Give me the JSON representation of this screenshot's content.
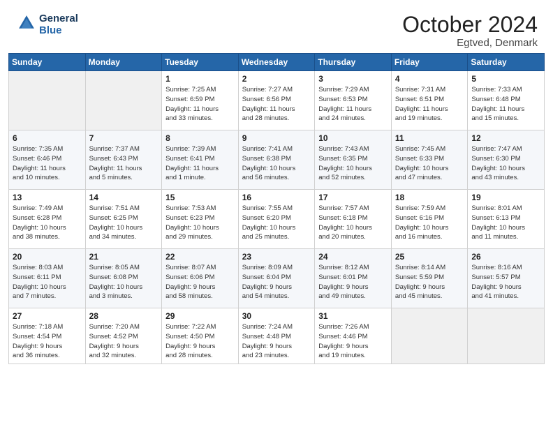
{
  "header": {
    "logo_line1": "General",
    "logo_line2": "Blue",
    "month": "October 2024",
    "location": "Egtved, Denmark"
  },
  "weekdays": [
    "Sunday",
    "Monday",
    "Tuesday",
    "Wednesday",
    "Thursday",
    "Friday",
    "Saturday"
  ],
  "rows": [
    [
      {
        "day": "",
        "detail": ""
      },
      {
        "day": "",
        "detail": ""
      },
      {
        "day": "1",
        "detail": "Sunrise: 7:25 AM\nSunset: 6:59 PM\nDaylight: 11 hours\nand 33 minutes."
      },
      {
        "day": "2",
        "detail": "Sunrise: 7:27 AM\nSunset: 6:56 PM\nDaylight: 11 hours\nand 28 minutes."
      },
      {
        "day": "3",
        "detail": "Sunrise: 7:29 AM\nSunset: 6:53 PM\nDaylight: 11 hours\nand 24 minutes."
      },
      {
        "day": "4",
        "detail": "Sunrise: 7:31 AM\nSunset: 6:51 PM\nDaylight: 11 hours\nand 19 minutes."
      },
      {
        "day": "5",
        "detail": "Sunrise: 7:33 AM\nSunset: 6:48 PM\nDaylight: 11 hours\nand 15 minutes."
      }
    ],
    [
      {
        "day": "6",
        "detail": "Sunrise: 7:35 AM\nSunset: 6:46 PM\nDaylight: 11 hours\nand 10 minutes."
      },
      {
        "day": "7",
        "detail": "Sunrise: 7:37 AM\nSunset: 6:43 PM\nDaylight: 11 hours\nand 5 minutes."
      },
      {
        "day": "8",
        "detail": "Sunrise: 7:39 AM\nSunset: 6:41 PM\nDaylight: 11 hours\nand 1 minute."
      },
      {
        "day": "9",
        "detail": "Sunrise: 7:41 AM\nSunset: 6:38 PM\nDaylight: 10 hours\nand 56 minutes."
      },
      {
        "day": "10",
        "detail": "Sunrise: 7:43 AM\nSunset: 6:35 PM\nDaylight: 10 hours\nand 52 minutes."
      },
      {
        "day": "11",
        "detail": "Sunrise: 7:45 AM\nSunset: 6:33 PM\nDaylight: 10 hours\nand 47 minutes."
      },
      {
        "day": "12",
        "detail": "Sunrise: 7:47 AM\nSunset: 6:30 PM\nDaylight: 10 hours\nand 43 minutes."
      }
    ],
    [
      {
        "day": "13",
        "detail": "Sunrise: 7:49 AM\nSunset: 6:28 PM\nDaylight: 10 hours\nand 38 minutes."
      },
      {
        "day": "14",
        "detail": "Sunrise: 7:51 AM\nSunset: 6:25 PM\nDaylight: 10 hours\nand 34 minutes."
      },
      {
        "day": "15",
        "detail": "Sunrise: 7:53 AM\nSunset: 6:23 PM\nDaylight: 10 hours\nand 29 minutes."
      },
      {
        "day": "16",
        "detail": "Sunrise: 7:55 AM\nSunset: 6:20 PM\nDaylight: 10 hours\nand 25 minutes."
      },
      {
        "day": "17",
        "detail": "Sunrise: 7:57 AM\nSunset: 6:18 PM\nDaylight: 10 hours\nand 20 minutes."
      },
      {
        "day": "18",
        "detail": "Sunrise: 7:59 AM\nSunset: 6:16 PM\nDaylight: 10 hours\nand 16 minutes."
      },
      {
        "day": "19",
        "detail": "Sunrise: 8:01 AM\nSunset: 6:13 PM\nDaylight: 10 hours\nand 11 minutes."
      }
    ],
    [
      {
        "day": "20",
        "detail": "Sunrise: 8:03 AM\nSunset: 6:11 PM\nDaylight: 10 hours\nand 7 minutes."
      },
      {
        "day": "21",
        "detail": "Sunrise: 8:05 AM\nSunset: 6:08 PM\nDaylight: 10 hours\nand 3 minutes."
      },
      {
        "day": "22",
        "detail": "Sunrise: 8:07 AM\nSunset: 6:06 PM\nDaylight: 9 hours\nand 58 minutes."
      },
      {
        "day": "23",
        "detail": "Sunrise: 8:09 AM\nSunset: 6:04 PM\nDaylight: 9 hours\nand 54 minutes."
      },
      {
        "day": "24",
        "detail": "Sunrise: 8:12 AM\nSunset: 6:01 PM\nDaylight: 9 hours\nand 49 minutes."
      },
      {
        "day": "25",
        "detail": "Sunrise: 8:14 AM\nSunset: 5:59 PM\nDaylight: 9 hours\nand 45 minutes."
      },
      {
        "day": "26",
        "detail": "Sunrise: 8:16 AM\nSunset: 5:57 PM\nDaylight: 9 hours\nand 41 minutes."
      }
    ],
    [
      {
        "day": "27",
        "detail": "Sunrise: 7:18 AM\nSunset: 4:54 PM\nDaylight: 9 hours\nand 36 minutes."
      },
      {
        "day": "28",
        "detail": "Sunrise: 7:20 AM\nSunset: 4:52 PM\nDaylight: 9 hours\nand 32 minutes."
      },
      {
        "day": "29",
        "detail": "Sunrise: 7:22 AM\nSunset: 4:50 PM\nDaylight: 9 hours\nand 28 minutes."
      },
      {
        "day": "30",
        "detail": "Sunrise: 7:24 AM\nSunset: 4:48 PM\nDaylight: 9 hours\nand 23 minutes."
      },
      {
        "day": "31",
        "detail": "Sunrise: 7:26 AM\nSunset: 4:46 PM\nDaylight: 9 hours\nand 19 minutes."
      },
      {
        "day": "",
        "detail": ""
      },
      {
        "day": "",
        "detail": ""
      }
    ]
  ]
}
